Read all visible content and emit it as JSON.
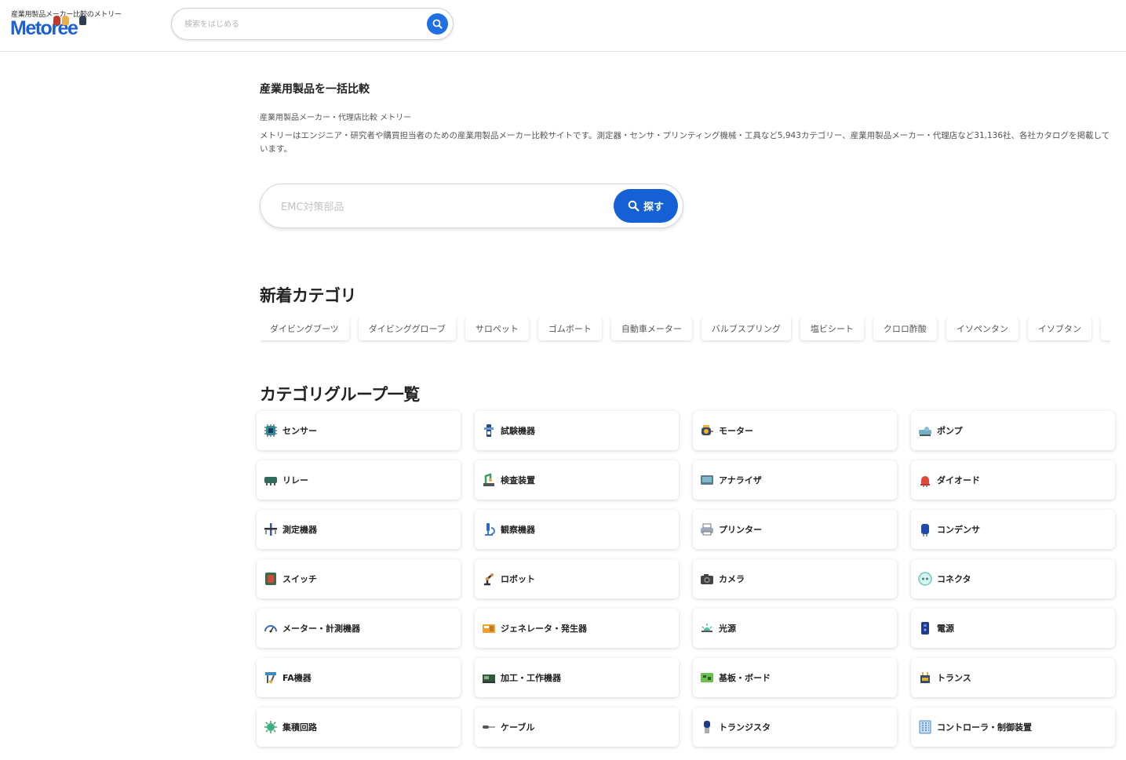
{
  "header": {
    "tagline": "産業用製品メーカー比較のメトリー",
    "logo_text": "Metoree",
    "search_placeholder": "検索をはじめる"
  },
  "intro": {
    "title": "産業用製品を一括比較",
    "subtitle": "産業用製品メーカー・代理店比較 メトリー",
    "description": "メトリーはエンジニア・研究者や購買担当者のための産業用製品メーカー比較サイトです。測定器・センサ・プリンティング機械・工具など5,943カテゴリー、産業用製品メーカー・代理店など31,136社、各社カタログを掲載しています。"
  },
  "main_search": {
    "placeholder": "EMC対策部品",
    "button_label": "探す"
  },
  "new_categories": {
    "title": "新着カテゴリ",
    "items": [
      "ダイビングブーツ",
      "ダイビンググローブ",
      "サロペット",
      "ゴムボート",
      "自動車メーター",
      "バルブスプリング",
      "塩ビシート",
      "クロロ酢酸",
      "イソペンタン",
      "イソブタン",
      ""
    ]
  },
  "category_groups": {
    "title": "カテゴリグループ一覧",
    "items": [
      {
        "label": "センサー",
        "icon": "sensor-chip-icon",
        "color": "#2e8b9a"
      },
      {
        "label": "試験機器",
        "icon": "test-equipment-icon",
        "color": "#2a4a8a"
      },
      {
        "label": "モーター",
        "icon": "motor-icon",
        "color": "#f0b32a"
      },
      {
        "label": "ポンプ",
        "icon": "pump-icon",
        "color": "#6fb0c8"
      },
      {
        "label": "リレー",
        "icon": "relay-icon",
        "color": "#2f6b5a"
      },
      {
        "label": "検査装置",
        "icon": "inspection-icon",
        "color": "#3f9a6a"
      },
      {
        "label": "アナライザ",
        "icon": "analyzer-icon",
        "color": "#7fb8c8"
      },
      {
        "label": "ダイオード",
        "icon": "diode-icon",
        "color": "#e04a3a"
      },
      {
        "label": "測定機器",
        "icon": "measuring-icon",
        "color": "#3a5aa8"
      },
      {
        "label": "観察機器",
        "icon": "microscope-icon",
        "color": "#2a6ac8"
      },
      {
        "label": "プリンター",
        "icon": "printer-icon",
        "color": "#9aa8b8"
      },
      {
        "label": "コンデンサ",
        "icon": "capacitor-icon",
        "color": "#1f4aa8"
      },
      {
        "label": "スイッチ",
        "icon": "switch-icon",
        "color": "#d04a3a"
      },
      {
        "label": "ロボット",
        "icon": "robot-arm-icon",
        "color": "#e08a3a"
      },
      {
        "label": "カメラ",
        "icon": "camera-icon",
        "color": "#444444"
      },
      {
        "label": "コネクタ",
        "icon": "connector-icon",
        "color": "#6fc8c0"
      },
      {
        "label": "メーター・計測機器",
        "icon": "gauge-icon",
        "color": "#3a6ab8"
      },
      {
        "label": "ジェネレータ・発生器",
        "icon": "generator-icon",
        "color": "#f0a030"
      },
      {
        "label": "光源",
        "icon": "light-source-icon",
        "color": "#4fc0a0"
      },
      {
        "label": "電源",
        "icon": "power-supply-icon",
        "color": "#1f3a8a"
      },
      {
        "label": "FA機器",
        "icon": "fa-equipment-icon",
        "color": "#3a8ac8"
      },
      {
        "label": "加工・工作機器",
        "icon": "machine-tool-icon",
        "color": "#2f5a3a"
      },
      {
        "label": "基板・ボード",
        "icon": "circuit-board-icon",
        "color": "#6ac04a"
      },
      {
        "label": "トランス",
        "icon": "transformer-icon",
        "color": "#e0b030"
      },
      {
        "label": "集積回路",
        "icon": "integrated-circuit-icon",
        "color": "#3ab080"
      },
      {
        "label": "ケーブル",
        "icon": "cable-icon",
        "color": "#555555"
      },
      {
        "label": "トランジスタ",
        "icon": "transistor-icon",
        "color": "#1f3a8a"
      },
      {
        "label": "コントローラ・制御装置",
        "icon": "controller-icon",
        "color": "#4a8ac8"
      }
    ]
  }
}
